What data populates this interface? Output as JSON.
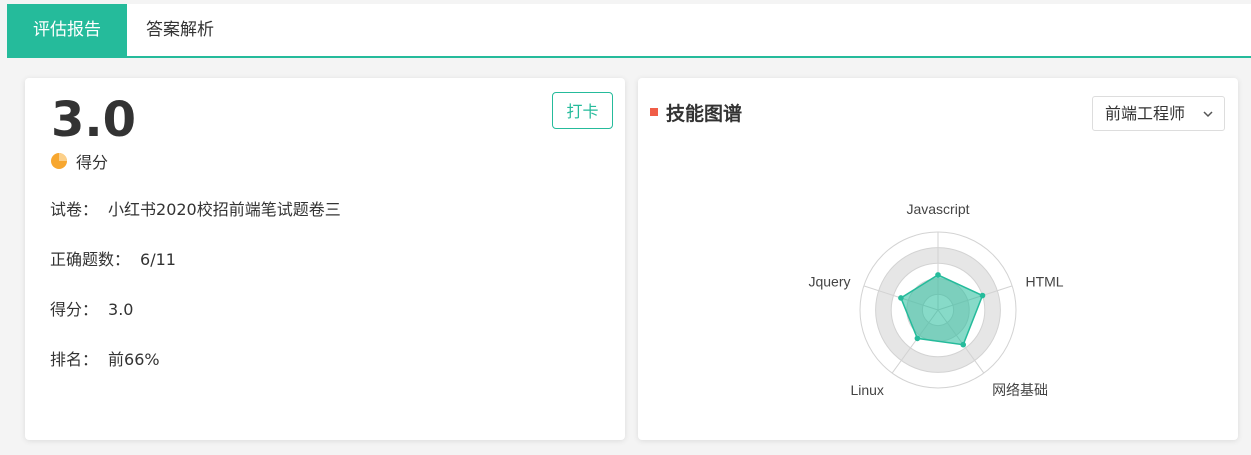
{
  "tabs": [
    {
      "label": "评估报告",
      "active": true
    },
    {
      "label": "答案解析",
      "active": false
    }
  ],
  "summary": {
    "score": "3.0",
    "score_label": "得分",
    "checkin_label": "打卡",
    "score_icon": "pie-chart-icon",
    "rows": [
      {
        "key": "试卷：",
        "value": "小红书2020校招前端笔试题卷三"
      },
      {
        "key": "正确题数：",
        "value": "6/11"
      },
      {
        "key": "得分：",
        "value": "3.0"
      },
      {
        "key": "排名：",
        "value": "前66%"
      }
    ]
  },
  "skills": {
    "title": "技能图谱",
    "role_select": "前端工程师",
    "accent": "#25bb9b",
    "title_mark_color": "#f05d47"
  },
  "chart_data": {
    "type": "radar",
    "indicators": [
      "Javascript",
      "HTML",
      "网络基础",
      "Linux",
      "Jquery"
    ],
    "values": [
      0.45,
      0.6,
      0.55,
      0.45,
      0.5
    ],
    "max": 1,
    "color": "#25bb9b"
  }
}
